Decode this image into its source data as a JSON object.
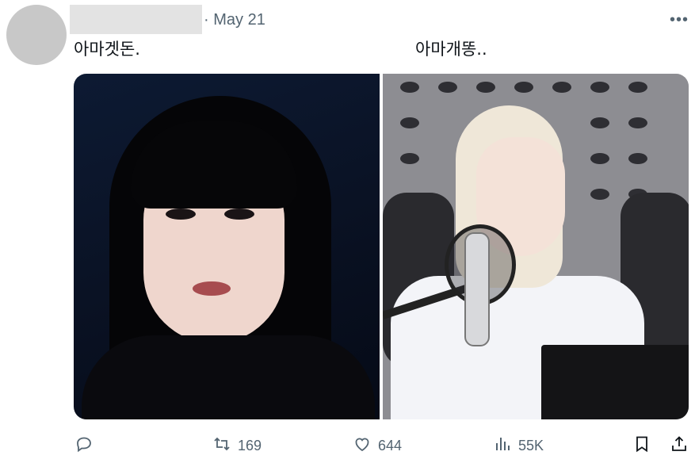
{
  "post": {
    "date": "May 21",
    "separator": "·",
    "caption_left": "아마겟돈.",
    "caption_right": "아마개똥.."
  },
  "icons": {
    "more": "more-icon",
    "reply": "reply-icon",
    "retweet": "retweet-icon",
    "like": "heart-icon",
    "views": "views-icon",
    "bookmark": "bookmark-icon",
    "share": "share-icon"
  },
  "stats": {
    "retweets": "169",
    "likes": "644",
    "views": "55K"
  },
  "colors": {
    "secondary_text": "#536471",
    "primary_text": "#0f1419"
  }
}
